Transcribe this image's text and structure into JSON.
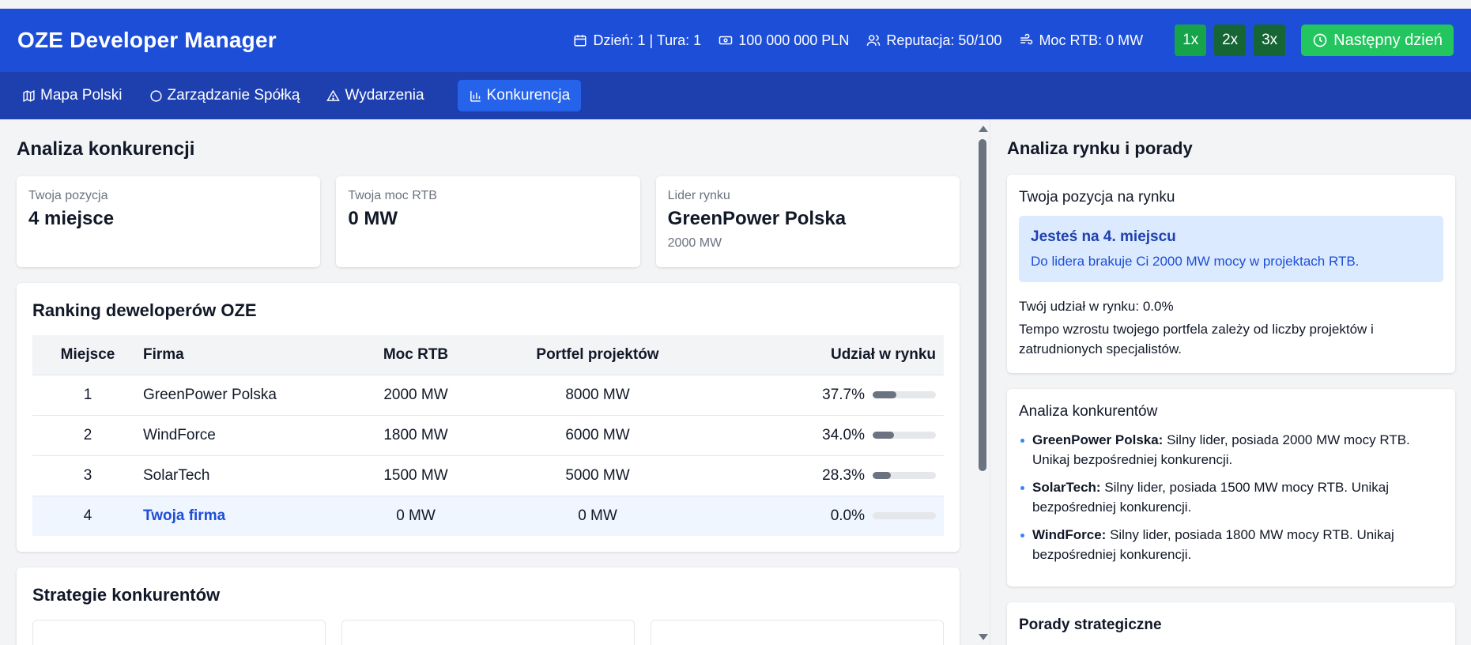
{
  "header": {
    "title": "OZE Developer Manager",
    "day_turn": "Dzień: 1 | Tura: 1",
    "money": "100 000 000 PLN",
    "reputation": "Reputacja: 50/100",
    "rtb_power": "Moc RTB: 0 MW",
    "speeds": [
      "1x",
      "2x",
      "3x"
    ],
    "next_day": "Następny dzień"
  },
  "nav": {
    "tabs": [
      {
        "label": "Mapa Polski",
        "icon": "map-icon"
      },
      {
        "label": "Zarządzanie Spółką",
        "icon": "circle-icon"
      },
      {
        "label": "Wydarzenia",
        "icon": "warning-icon"
      },
      {
        "label": "Konkurencja",
        "icon": "bar-chart-icon",
        "active": true
      }
    ]
  },
  "competition": {
    "title": "Analiza konkurencji",
    "cards": [
      {
        "label": "Twoja pozycja",
        "value": "4 miejsce"
      },
      {
        "label": "Twoja moc RTB",
        "value": "0 MW"
      },
      {
        "label": "Lider rynku",
        "value": "GreenPower Polska",
        "sub": "2000 MW"
      }
    ],
    "ranking": {
      "title": "Ranking deweloperów OZE",
      "columns": [
        "Miejsce",
        "Firma",
        "Moc RTB",
        "Portfel projektów",
        "Udział w rynku"
      ],
      "rows": [
        {
          "rank": "1",
          "firm": "GreenPower Polska",
          "rtb": "2000 MW",
          "portfolio": "8000 MW",
          "share": "37.7%",
          "share_value": 37.7
        },
        {
          "rank": "2",
          "firm": "WindForce",
          "rtb": "1800 MW",
          "portfolio": "6000 MW",
          "share": "34.0%",
          "share_value": 34.0
        },
        {
          "rank": "3",
          "firm": "SolarTech",
          "rtb": "1500 MW",
          "portfolio": "5000 MW",
          "share": "28.3%",
          "share_value": 28.3
        },
        {
          "rank": "4",
          "firm": "Twoja firma",
          "rtb": "0 MW",
          "portfolio": "0 MW",
          "share": "0.0%",
          "share_value": 0.0
        }
      ]
    },
    "strategies_title": "Strategie konkurentów"
  },
  "advice": {
    "title": "Analiza rynku i porady",
    "position": {
      "title": "Twoja pozycja na rynku",
      "box_title": "Jesteś na 4. miejscu",
      "box_text": "Do lidera brakuje Ci 2000 MW mocy w projektach RTB.",
      "share": "Twój udział w rynku: 0.0%",
      "note": "Tempo wzrostu twojego portfela zależy od liczby projektów i zatrudnionych specjalistów."
    },
    "competitors": {
      "title": "Analiza konkurentów",
      "items": [
        {
          "name": "GreenPower Polska:",
          "text": " Silny lider, posiada 2000 MW mocy RTB. Unikaj bezpośredniej konkurencji."
        },
        {
          "name": "SolarTech:",
          "text": " Silny lider, posiada 1500 MW mocy RTB. Unikaj bezpośredniej konkurencji."
        },
        {
          "name": "WindForce:",
          "text": " Silny lider, posiada 1800 MW mocy RTB. Unikaj bezpośredniej konkurencji."
        }
      ]
    },
    "strategic_title": "Porady strategiczne"
  },
  "colors": {
    "header_bg": "#1d4ed8",
    "nav_bg": "#1e40af",
    "active_tab": "#2563eb",
    "speed_btn": "#16a34a",
    "next_btn": "#22c55e",
    "link_blue": "#1d4ed8"
  }
}
